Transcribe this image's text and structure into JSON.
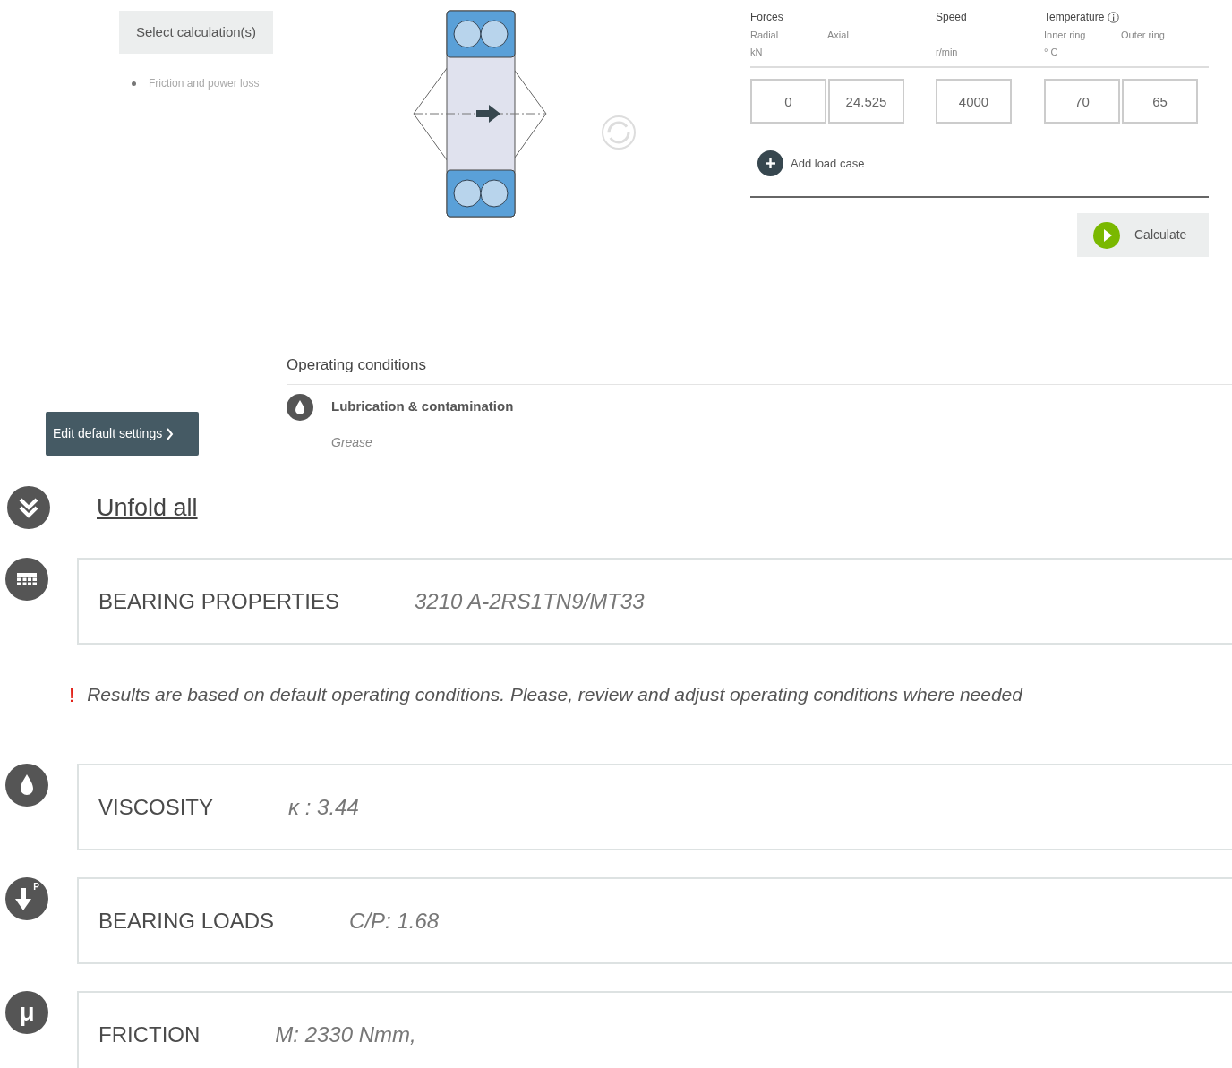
{
  "calculation_button": "Select calculation(s)",
  "calculations": [
    "Friction and power loss"
  ],
  "inputs": {
    "groups": [
      {
        "heading": "Forces",
        "info": false,
        "unit": "kN",
        "fields": [
          {
            "label": "Radial",
            "value": "0"
          },
          {
            "label": "Axial",
            "value": "24.525"
          }
        ]
      },
      {
        "heading": "Speed",
        "info": false,
        "unit": "r/min",
        "fields": [
          {
            "value": "4000"
          }
        ]
      },
      {
        "heading": "Temperature",
        "info": true,
        "unit": "° C",
        "fields": [
          {
            "label": "Inner ring",
            "value": "70"
          },
          {
            "label": "Outer ring",
            "value": "65"
          }
        ]
      }
    ],
    "add_button": "Add load case",
    "calculate_button": "Calculate"
  },
  "operating_conditions": {
    "title": "Operating conditions",
    "items": [
      {
        "title": "Lubrication & contamination",
        "value": "Grease"
      }
    ]
  },
  "edit_button": "Edit default settings",
  "unfold_link": "Unfold all",
  "sections": [
    {
      "kind": "properties",
      "title": "BEARING PROPERTIES",
      "value": "3210 A-2RS1TN9/MT33"
    },
    {
      "kind": "warning",
      "mark": "!",
      "text": "Results are based on default operating conditions. Please, review and adjust operating conditions where needed"
    },
    {
      "kind": "viscosity",
      "title": "VISCOSITY",
      "value": "κ : 3.44"
    },
    {
      "kind": "loads",
      "title": "BEARING LOADS",
      "value": "C/P: 1.68",
      "icon_letter": "P"
    },
    {
      "kind": "friction",
      "title": "FRICTION",
      "value": "M: 2330 Nmm,",
      "icon_letter": "μ"
    }
  ]
}
